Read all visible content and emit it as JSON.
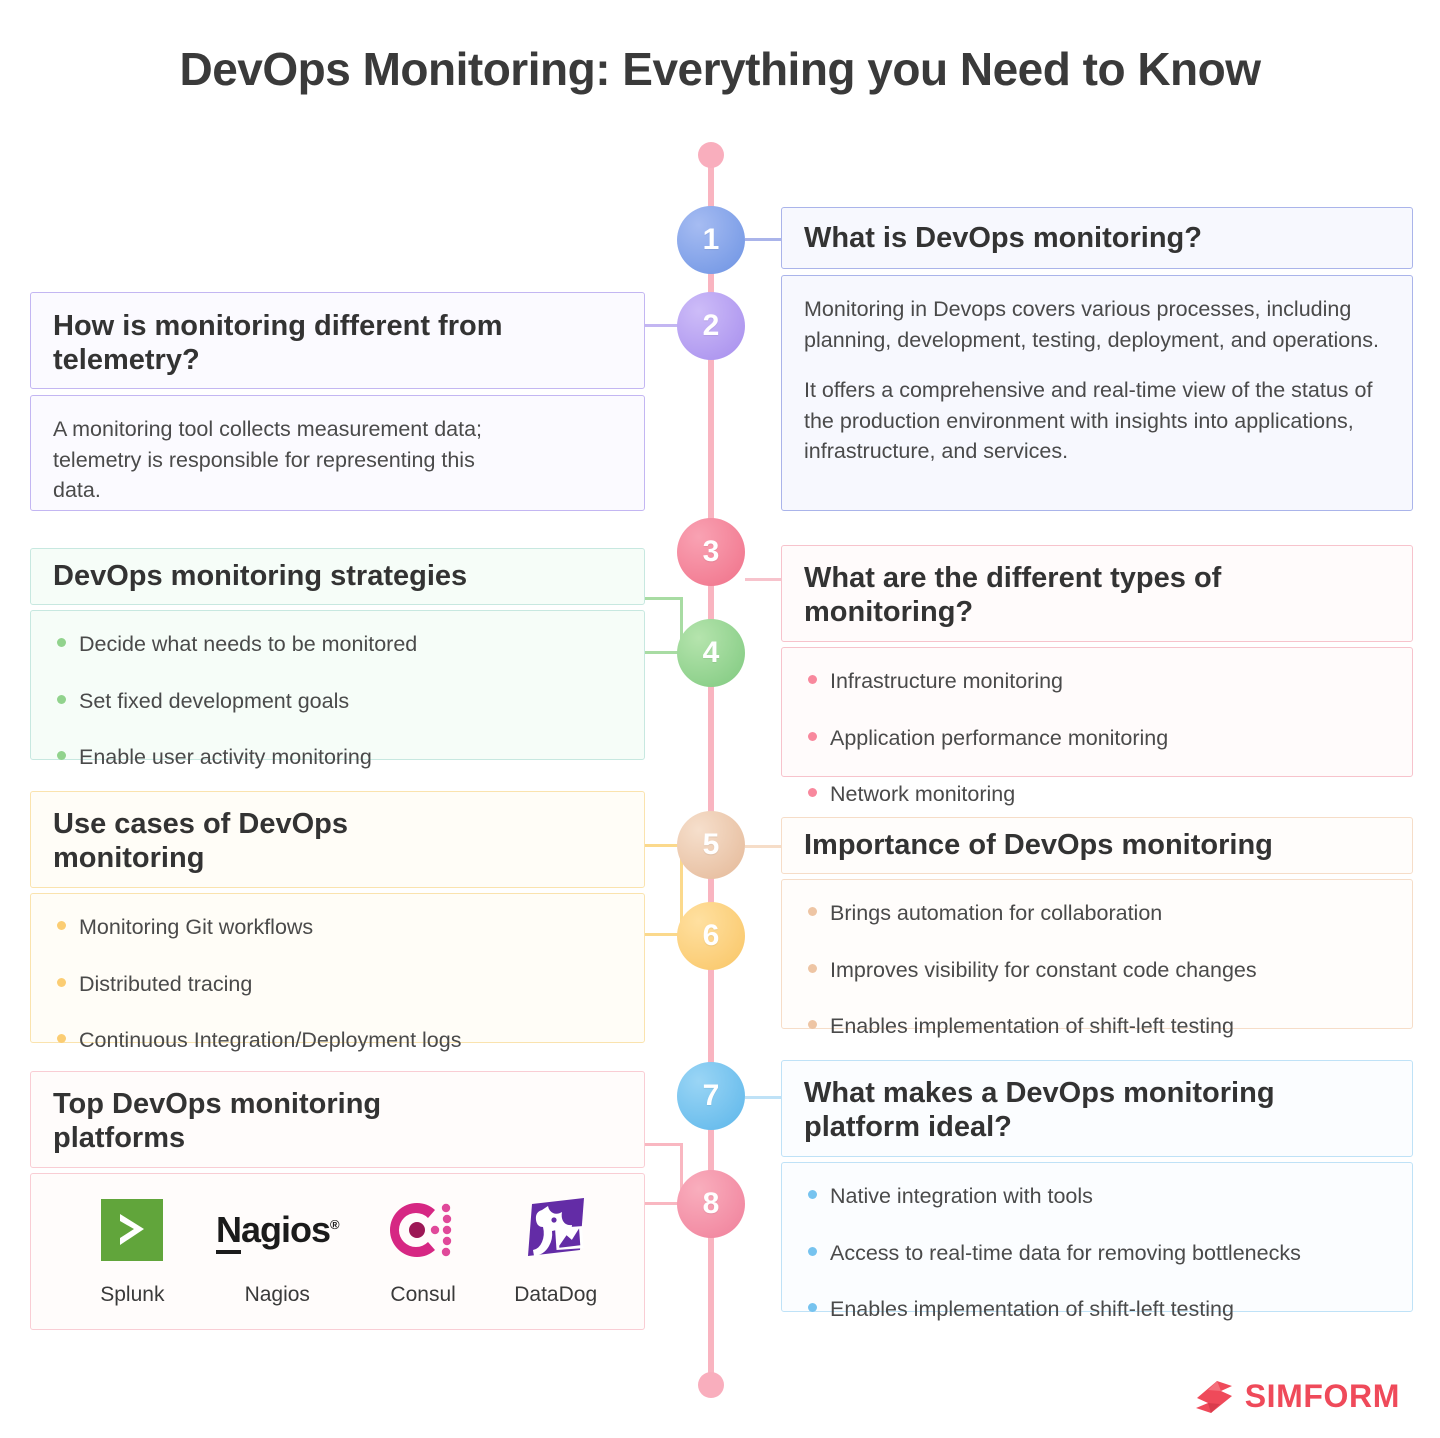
{
  "title": "DevOps Monitoring: Everything you Need to Know",
  "brand": {
    "name": "SIMFORM",
    "color": "#ef4a5a"
  },
  "timeline": {
    "nodes": [
      {
        "number": "1",
        "color": "#7d9ee8"
      },
      {
        "number": "2",
        "color": "#b09cf0"
      },
      {
        "number": "3",
        "color": "#f47f95"
      },
      {
        "number": "4",
        "color": "#92d68e"
      },
      {
        "number": "5",
        "color": "#ecc2a5"
      },
      {
        "number": "6",
        "color": "#fbcd73"
      },
      {
        "number": "7",
        "color": "#70c2f0"
      },
      {
        "number": "8",
        "color": "#f4889e"
      }
    ],
    "spine_color": "#f9b4c0"
  },
  "sections": [
    {
      "id": "what-is-devops-monitoring",
      "number": "1",
      "side": "right",
      "heading": "What is DevOps monitoring?",
      "accent": "#aab4ea",
      "fill": "#f7f8fe",
      "paragraphs": [
        "Monitoring in Devops covers various processes, including planning, development, testing, deployment, and operations.",
        "It offers a comprehensive and real-time view of the status of the production environment with insights into applications, infrastructure, and services."
      ]
    },
    {
      "id": "monitoring-vs-telemetry",
      "number": "2",
      "side": "left",
      "heading": "How is monitoring different from telemetry?",
      "accent": "#c3b6f2",
      "fill": "#fbfaff",
      "paragraphs": [
        "A monitoring tool collects measurement data; telemetry is responsible for representing this data."
      ]
    },
    {
      "id": "types-of-monitoring",
      "number": "3",
      "side": "right",
      "heading": "What are the different types of monitoring?",
      "accent": "#f7c3cc",
      "fill": "#fffbfb",
      "bullet_color": "#f8889d",
      "bullets": [
        "Infrastructure monitoring",
        "Application performance monitoring",
        "Network monitoring"
      ]
    },
    {
      "id": "monitoring-strategies",
      "number": "4",
      "side": "left",
      "heading": "DevOps monitoring strategies",
      "accent": "#c7e8e0",
      "fill": "#f6fdf8",
      "bullet_color": "#91d38d",
      "bullets": [
        "Decide what needs to be monitored",
        "Set fixed development goals",
        "Enable user activity monitoring"
      ]
    },
    {
      "id": "importance-of-devops-monitoring",
      "number": "5",
      "side": "right",
      "heading": "Importance of DevOps monitoring",
      "accent": "#f6ddc8",
      "fill": "#fffdfb",
      "bullet_color": "#eec5a4",
      "bullets": [
        "Brings automation for collaboration",
        "Improves visibility for constant code changes",
        "Enables implementation of shift-left testing"
      ]
    },
    {
      "id": "use-cases-of-devops-monitoring",
      "number": "6",
      "side": "left",
      "heading": "Use cases of DevOps monitoring",
      "accent": "#fae3ae",
      "fill": "#fffdf7",
      "bullet_color": "#fbcd73",
      "bullets": [
        "Monitoring Git workflows",
        " Distributed tracing",
        "Continuous Integration/Deployment logs"
      ]
    },
    {
      "id": "ideal-monitoring-platform",
      "number": "7",
      "side": "right",
      "heading": "What makes a DevOps monitoring platform ideal?",
      "accent": "#bfe2f7",
      "fill": "#fbfdff",
      "bullet_color": "#76c3ef",
      "bullets": [
        "Native integration with tools",
        "Access to real-time data for removing bottlenecks",
        "Enables implementation of shift-left testing"
      ]
    },
    {
      "id": "top-monitoring-platforms",
      "number": "8",
      "side": "left",
      "heading": "Top DevOps monitoring platforms",
      "accent": "#f9cdd4",
      "fill": "#fffcfb"
    }
  ],
  "platforms": [
    {
      "name": "Splunk",
      "icon": "splunk-logo",
      "color": "#61a53b"
    },
    {
      "name": "Nagios",
      "icon": "nagios-logo",
      "color": "#1b1b1b"
    },
    {
      "name": "Consul",
      "icon": "consul-logo",
      "color": "#d62783"
    },
    {
      "name": "DataDog",
      "icon": "datadog-logo",
      "color": "#632ca6"
    }
  ]
}
